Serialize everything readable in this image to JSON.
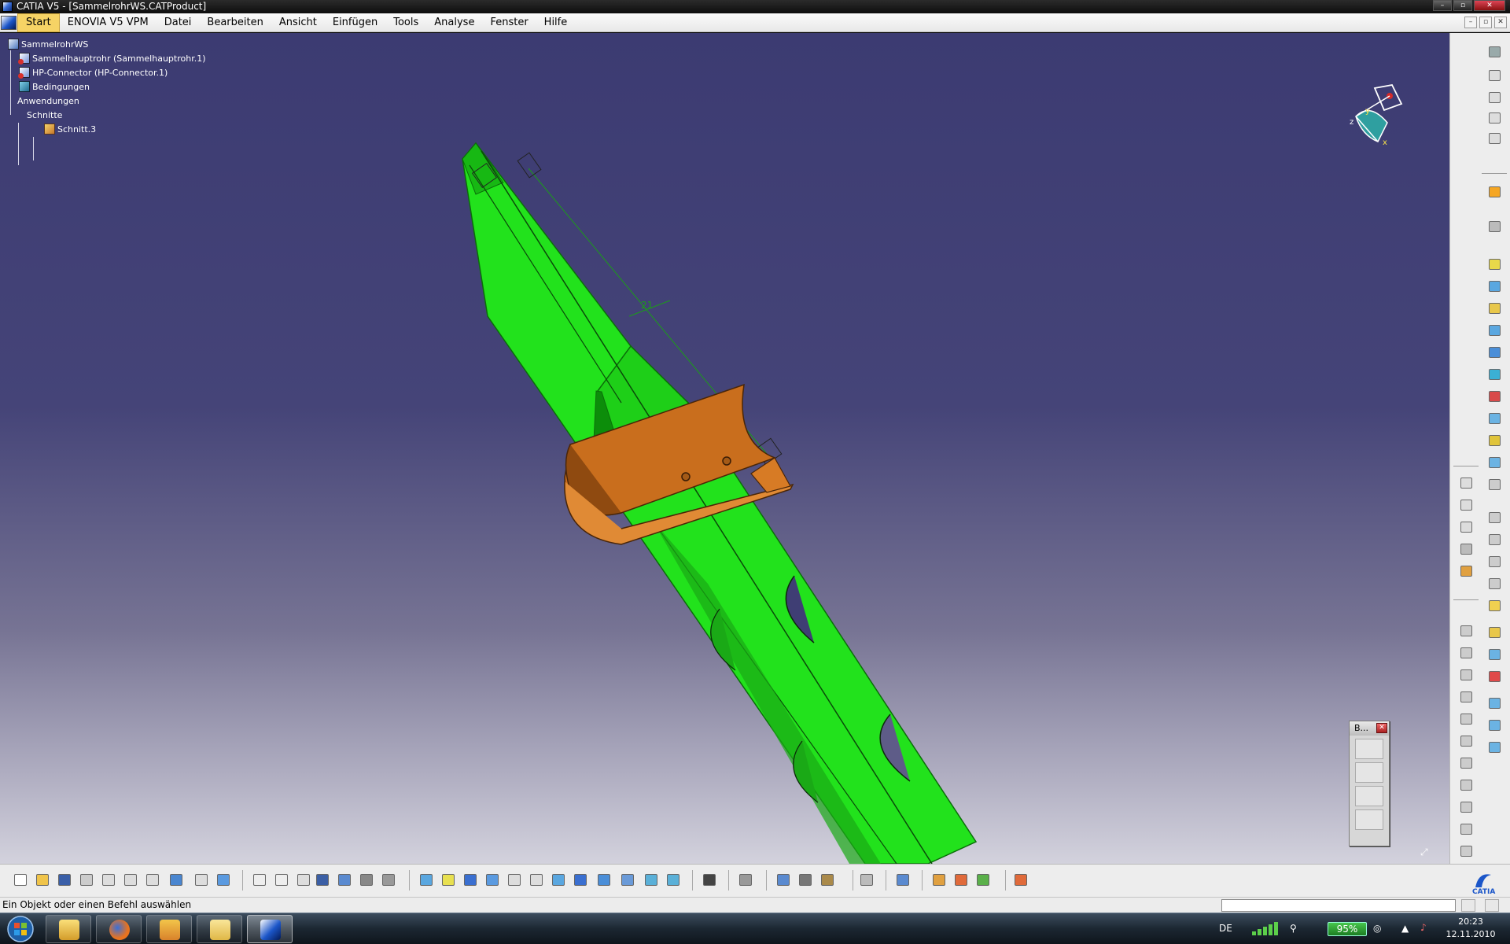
{
  "window": {
    "title": "CATIA V5 - [SammelrohrWS.CATProduct]",
    "caption_buttons": [
      "minimize-icon",
      "restore-icon",
      "close-icon"
    ]
  },
  "menubar": {
    "items": [
      "Start",
      "ENOVIA V5 VPM",
      "Datei",
      "Bearbeiten",
      "Ansicht",
      "Einfügen",
      "Tools",
      "Analyse",
      "Fenster",
      "Hilfe"
    ],
    "active_item": "Start"
  },
  "spec_tree": {
    "root": "SammelrohrWS",
    "nodes": [
      {
        "label": "Sammelhauptrohr (Sammelhauptrohr.1)",
        "icon": "part-icon"
      },
      {
        "label": "HP-Connector (HP-Connector.1)",
        "icon": "part-icon"
      },
      {
        "label": "Bedingungen",
        "icon": "constraints-icon"
      },
      {
        "label": "Anwendungen",
        "icon": "none"
      },
      {
        "label": "Schnitte",
        "icon": "none"
      },
      {
        "label": "Schnitt.3",
        "icon": "section-icon"
      }
    ]
  },
  "viewport": {
    "dimension_label": "21",
    "colors": {
      "background_top": "#3c3b72",
      "background_bottom": "#d3d2dd",
      "pipe": "#22e21c",
      "pipe_dark": "#0c8d0a",
      "connector": "#c96e1d"
    },
    "compass_axes": [
      "x",
      "y",
      "z"
    ]
  },
  "floating_toolbar": {
    "title": "B..."
  },
  "status": {
    "message": "Ein Objekt oder einen Befehl auswählen",
    "command_input_value": ""
  },
  "taskbar": {
    "apps": [
      "windows-explorer-icon",
      "firefox-icon",
      "outlook-icon",
      "folder-icon",
      "catia-icon"
    ],
    "language": "DE",
    "battery": "95%",
    "time": "20:23",
    "date": "12.11.2010"
  }
}
